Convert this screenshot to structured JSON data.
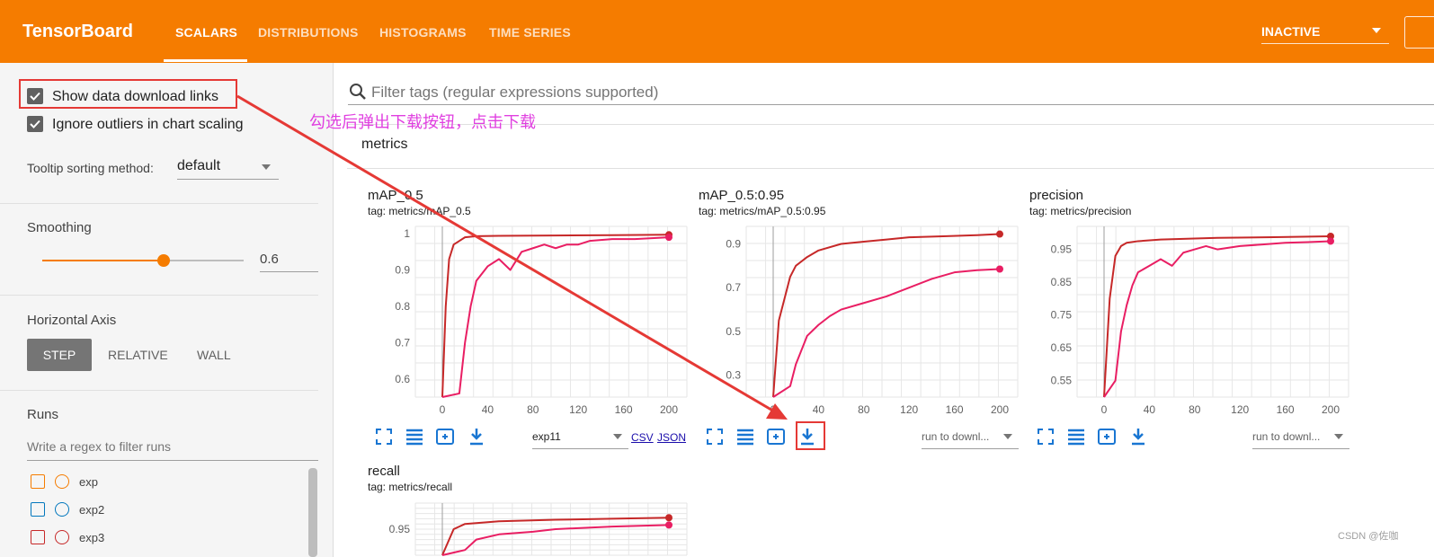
{
  "header": {
    "brand": "TensorBoard",
    "tabs": [
      {
        "label": "SCALARS",
        "active": true
      },
      {
        "label": "DISTRIBUTIONS",
        "active": false
      },
      {
        "label": "HISTOGRAMS",
        "active": false
      },
      {
        "label": "TIME SERIES",
        "active": false
      }
    ],
    "run_state": "INACTIVE",
    "accent_color": "#f57c00"
  },
  "sidebar": {
    "show_download_links": {
      "label": "Show data download links",
      "checked": true
    },
    "ignore_outliers": {
      "label": "Ignore outliers in chart scaling",
      "checked": true
    },
    "tooltip_sorting": {
      "label": "Tooltip sorting method:",
      "value": "default"
    },
    "smoothing": {
      "label": "Smoothing",
      "value": "0.6",
      "fraction": 0.6
    },
    "horizontal_axis": {
      "label": "Horizontal Axis",
      "options": [
        "STEP",
        "RELATIVE",
        "WALL"
      ],
      "selected": "STEP"
    },
    "runs": {
      "label": "Runs",
      "filter_placeholder": "Write a regex to filter runs",
      "items": [
        {
          "name": "exp",
          "color": "#f57c00"
        },
        {
          "name": "exp2",
          "color": "#0277bd"
        },
        {
          "name": "exp3",
          "color": "#c62828"
        }
      ]
    }
  },
  "main": {
    "filter_placeholder": "Filter tags (regular expressions supported)",
    "section_title": "metrics",
    "annotation": "勾选后弹出下载按钮，点击下载",
    "watermark": "CSDN @佐咖"
  },
  "charts": [
    {
      "title": "mAP_0.5",
      "tag": "tag: metrics/mAP_0.5",
      "yticks": [
        "1",
        "0.9",
        "0.8",
        "0.7",
        "0.6"
      ],
      "xticks": [
        "0",
        "40",
        "80",
        "120",
        "160",
        "200"
      ],
      "run_select": "exp11",
      "csv": "CSV",
      "json": "JSON"
    },
    {
      "title": "mAP_0.5:0.95",
      "tag": "tag: metrics/mAP_0.5:0.95",
      "yticks": [
        "0.9",
        "0.7",
        "0.5",
        "0.3"
      ],
      "xticks": [
        "0",
        "40",
        "80",
        "120",
        "160",
        "200"
      ],
      "run_select": "run to downl..."
    },
    {
      "title": "precision",
      "tag": "tag: metrics/precision",
      "yticks": [
        "0.95",
        "0.85",
        "0.75",
        "0.65",
        "0.55"
      ],
      "xticks": [
        "0",
        "40",
        "80",
        "120",
        "160",
        "200"
      ],
      "run_select": "run to downl..."
    },
    {
      "title": "recall",
      "tag": "tag: metrics/recall",
      "yticks": [
        "0.95"
      ],
      "xticks": []
    }
  ],
  "chart_data": [
    {
      "type": "line",
      "title": "mAP_0.5",
      "xlim": [
        0,
        200
      ],
      "ylim": [
        0.55,
        1.02
      ],
      "series": [
        {
          "color": "#c62828",
          "x": [
            0,
            3,
            6,
            10,
            15,
            20,
            30,
            50,
            100,
            150,
            200
          ],
          "y": [
            0.55,
            0.8,
            0.93,
            0.97,
            0.98,
            0.99,
            0.993,
            0.994,
            0.995,
            0.996,
            0.997
          ]
        },
        {
          "color": "#e91e63",
          "x": [
            0,
            15,
            20,
            25,
            30,
            40,
            50,
            60,
            70,
            80,
            90,
            100,
            110,
            120,
            130,
            150,
            170,
            200
          ],
          "y": [
            0.55,
            0.56,
            0.7,
            0.8,
            0.87,
            0.91,
            0.93,
            0.9,
            0.95,
            0.96,
            0.97,
            0.96,
            0.97,
            0.97,
            0.98,
            0.985,
            0.985,
            0.99
          ]
        }
      ]
    },
    {
      "type": "line",
      "title": "mAP_0.5:0.95",
      "xlim": [
        0,
        200
      ],
      "ylim": [
        0.2,
        0.98
      ],
      "series": [
        {
          "color": "#c62828",
          "x": [
            0,
            5,
            10,
            15,
            20,
            30,
            40,
            60,
            80,
            100,
            120,
            150,
            180,
            200
          ],
          "y": [
            0.2,
            0.55,
            0.65,
            0.75,
            0.8,
            0.84,
            0.87,
            0.9,
            0.91,
            0.92,
            0.93,
            0.935,
            0.94,
            0.945
          ]
        },
        {
          "color": "#e91e63",
          "x": [
            0,
            15,
            20,
            30,
            40,
            50,
            60,
            80,
            100,
            120,
            140,
            160,
            180,
            200
          ],
          "y": [
            0.2,
            0.25,
            0.35,
            0.48,
            0.53,
            0.57,
            0.6,
            0.63,
            0.66,
            0.7,
            0.74,
            0.77,
            0.78,
            0.785
          ]
        }
      ]
    },
    {
      "type": "line",
      "title": "precision",
      "xlim": [
        0,
        200
      ],
      "ylim": [
        0.5,
        1.02
      ],
      "series": [
        {
          "color": "#c62828",
          "x": [
            0,
            5,
            10,
            15,
            20,
            30,
            50,
            100,
            150,
            200
          ],
          "y": [
            0.5,
            0.8,
            0.93,
            0.96,
            0.97,
            0.975,
            0.98,
            0.985,
            0.987,
            0.99
          ]
        },
        {
          "color": "#e91e63",
          "x": [
            0,
            10,
            15,
            20,
            25,
            30,
            40,
            50,
            60,
            70,
            80,
            90,
            100,
            120,
            140,
            160,
            180,
            200
          ],
          "y": [
            0.5,
            0.55,
            0.7,
            0.78,
            0.84,
            0.88,
            0.9,
            0.92,
            0.9,
            0.94,
            0.95,
            0.96,
            0.95,
            0.96,
            0.965,
            0.97,
            0.972,
            0.975
          ]
        }
      ]
    },
    {
      "type": "line",
      "title": "recall",
      "xlim": [
        0,
        200
      ],
      "ylim": [
        0.9,
        1.0
      ],
      "series": [
        {
          "color": "#c62828",
          "x": [
            0,
            10,
            20,
            50,
            100,
            150,
            200
          ],
          "y": [
            0.9,
            0.95,
            0.96,
            0.965,
            0.968,
            0.97,
            0.972
          ]
        },
        {
          "color": "#e91e63",
          "x": [
            0,
            20,
            30,
            50,
            80,
            100,
            150,
            200
          ],
          "y": [
            0.9,
            0.91,
            0.93,
            0.94,
            0.945,
            0.95,
            0.955,
            0.958
          ]
        }
      ]
    }
  ]
}
